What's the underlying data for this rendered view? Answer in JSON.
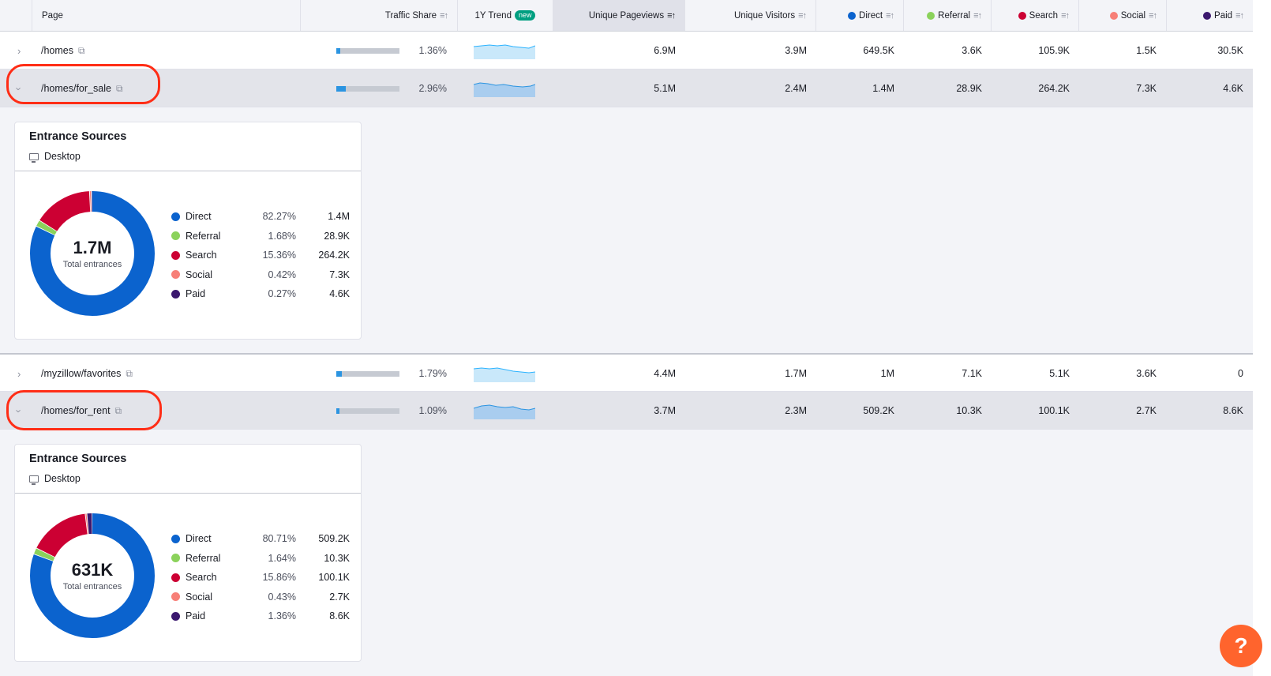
{
  "header": {
    "page": "Page",
    "traffic_share": "Traffic Share",
    "trend": "1Y Trend",
    "trend_badge": "new",
    "unique_pageviews": "Unique Pageviews",
    "unique_visitors": "Unique Visitors",
    "direct": "Direct",
    "referral": "Referral",
    "search": "Search",
    "social": "Social",
    "paid": "Paid"
  },
  "colors": {
    "direct": "#0b63ce",
    "referral": "#8bd25b",
    "search": "#cc0033",
    "social": "#f77f77",
    "paid": "#3b186e",
    "highlight": "#ff2d16",
    "help": "#ff642d"
  },
  "rows": [
    {
      "page": "/homes",
      "share": "1.36%",
      "share_value": 0.0136,
      "pageviews": "6.9M",
      "visitors": "3.9M",
      "direct": "649.5K",
      "referral": "3.6K",
      "search": "105.9K",
      "social": "1.5K",
      "paid": "30.5K"
    },
    {
      "page": "/homes/for_sale",
      "share": "2.96%",
      "share_value": 0.0296,
      "pageviews": "5.1M",
      "visitors": "2.4M",
      "direct": "1.4M",
      "referral": "28.9K",
      "search": "264.2K",
      "social": "7.3K",
      "paid": "4.6K"
    },
    {
      "page": "/myzillow/favorites",
      "share": "1.79%",
      "share_value": 0.0179,
      "pageviews": "4.4M",
      "visitors": "1.7M",
      "direct": "1M",
      "referral": "7.1K",
      "search": "5.1K",
      "social": "3.6K",
      "paid": "0"
    },
    {
      "page": "/homes/for_rent",
      "share": "1.09%",
      "share_value": 0.0109,
      "pageviews": "3.7M",
      "visitors": "2.3M",
      "direct": "509.2K",
      "referral": "10.3K",
      "search": "100.1K",
      "social": "2.7K",
      "paid": "8.6K"
    }
  ],
  "panels": [
    {
      "title": "Entrance Sources",
      "device": "Desktop",
      "total": "1.7M",
      "total_label": "Total entrances",
      "items": [
        {
          "name": "Direct",
          "pct": "82.27%",
          "value": "1.4M",
          "share": 82.27
        },
        {
          "name": "Referral",
          "pct": "1.68%",
          "value": "28.9K",
          "share": 1.68
        },
        {
          "name": "Search",
          "pct": "15.36%",
          "value": "264.2K",
          "share": 15.36
        },
        {
          "name": "Social",
          "pct": "0.42%",
          "value": "7.3K",
          "share": 0.42
        },
        {
          "name": "Paid",
          "pct": "0.27%",
          "value": "4.6K",
          "share": 0.27
        }
      ]
    },
    {
      "title": "Entrance Sources",
      "device": "Desktop",
      "total": "631K",
      "total_label": "Total entrances",
      "items": [
        {
          "name": "Direct",
          "pct": "80.71%",
          "value": "509.2K",
          "share": 80.71
        },
        {
          "name": "Referral",
          "pct": "1.64%",
          "value": "10.3K",
          "share": 1.64
        },
        {
          "name": "Search",
          "pct": "15.86%",
          "value": "100.1K",
          "share": 15.86
        },
        {
          "name": "Social",
          "pct": "0.43%",
          "value": "2.7K",
          "share": 0.43
        },
        {
          "name": "Paid",
          "pct": "1.36%",
          "value": "8.6K",
          "share": 1.36
        }
      ]
    }
  ],
  "help": {
    "label": "?"
  }
}
